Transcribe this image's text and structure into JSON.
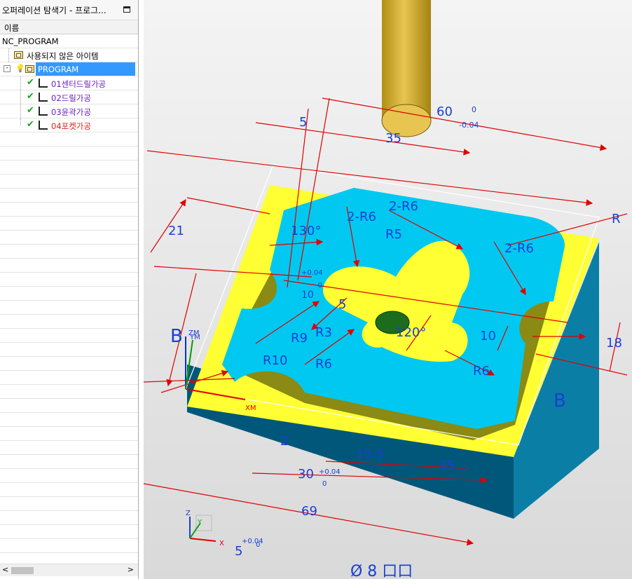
{
  "navigator": {
    "title": "오퍼레이션 탐색기 - 프로그...",
    "column_header": "이름",
    "root": "NC_PROGRAM",
    "items": [
      {
        "label": "사용되지 않은 아이템"
      },
      {
        "label": "PROGRAM",
        "selected": true
      },
      {
        "label": "01센터드릴가공",
        "color": "#6a1fc2"
      },
      {
        "label": "02드릴가공",
        "color": "#6a1fc2"
      },
      {
        "label": "03윤곽가공",
        "color": "#6a1fc2"
      },
      {
        "label": "04포켓가공",
        "color": "#d9261c"
      }
    ],
    "scroll_left": "<",
    "scroll_right": ">"
  },
  "viewport": {
    "dimensions": [
      "60",
      "0",
      "-0.04",
      "35",
      "5",
      "2-R6",
      "2-R6",
      "R5",
      "2-R6",
      "130°",
      "21",
      "10",
      "-0",
      "+0.04",
      "5",
      "R9",
      "R3",
      "120°",
      "10",
      "18",
      "R10",
      "R6",
      "R6",
      "B",
      "B",
      "2",
      "15.5",
      "15",
      "30",
      "+0.04",
      "0",
      "69",
      "5",
      "+0.04",
      "0",
      "Ø 8 口口",
      "R"
    ],
    "axis_labels": {
      "zm": "ZM",
      "ym": "YM",
      "xm": "XM",
      "z": "Z",
      "y": "Y",
      "x": "X"
    }
  }
}
